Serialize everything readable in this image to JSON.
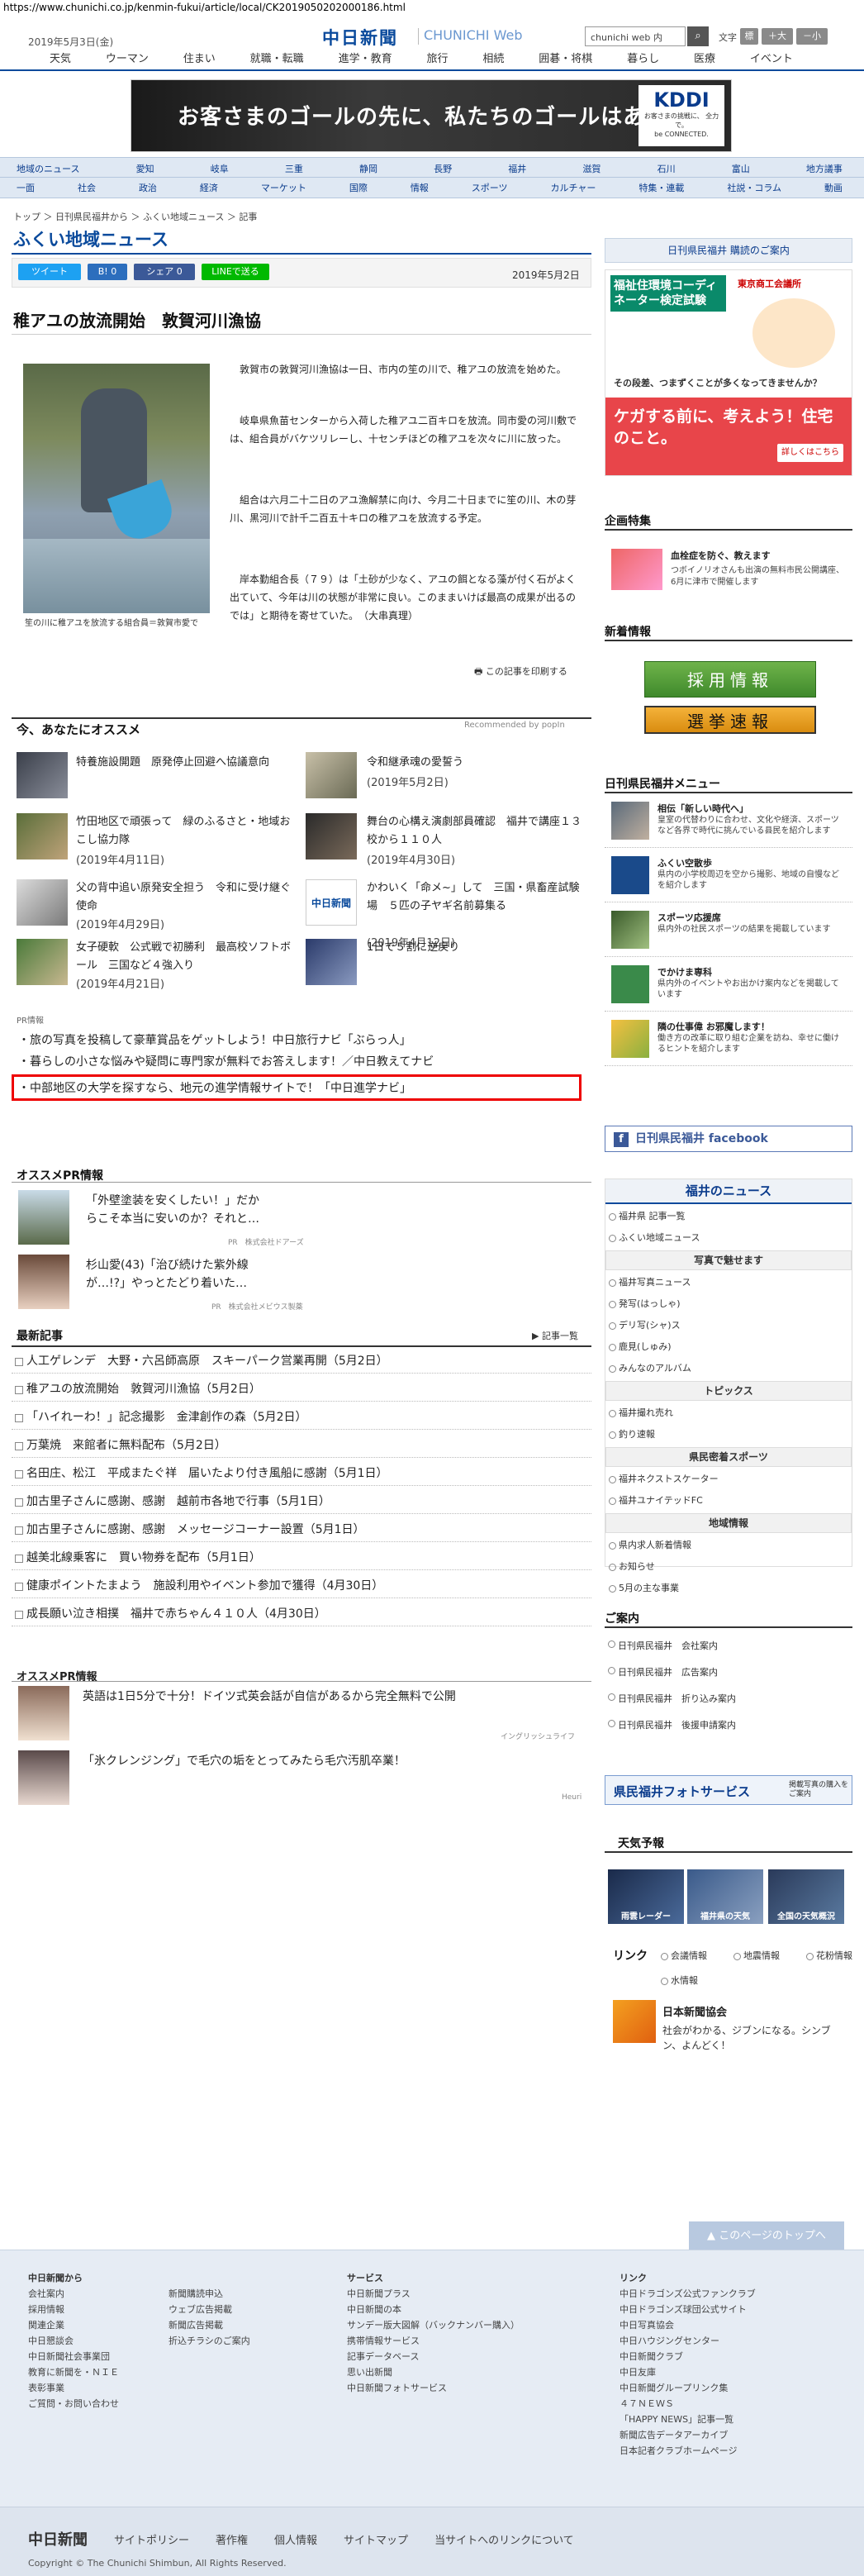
{
  "url": "https://www.chunichi.co.jp/kenmin-fukui/article/local/CK2019050202000186.html",
  "header": {
    "date": "2019年5月3日(金)",
    "logo_main": "中日新聞",
    "logo_web": "CHUNICHI Web",
    "search_placeholder": "chunichi web 内",
    "search_icon": "search-icon",
    "font_label": "文字",
    "font_buttons": [
      "標",
      "＋大",
      "－小"
    ],
    "gnav": [
      "天気",
      "ウーマン",
      "住まい",
      "就職・転職",
      "進学・教育",
      "旅行",
      "相続",
      "囲碁・将棋",
      "暮らし",
      "医療",
      "イベント"
    ]
  },
  "banner": {
    "text": "お客さまのゴールの先に、私たちのゴールはある。",
    "brand": "KDDI",
    "sub": "お客さまの挑戦に、\n全力で。",
    "tag": "be CONNECTED."
  },
  "catnav": {
    "row1": [
      "地域のニュース",
      "愛知",
      "岐阜",
      "三重",
      "静岡",
      "長野",
      "福井",
      "滋賀",
      "石川",
      "富山",
      "地方議事"
    ],
    "row2": [
      "一面",
      "社会",
      "政治",
      "経済",
      "マーケット",
      "国際",
      "情報",
      "スポーツ",
      "カルチャー",
      "特集・連載",
      "社説・コラム",
      "動画"
    ]
  },
  "breadcrumb": "トップ ＞ 日刊県民福井から ＞ ふくい地域ニュース ＞ 記事",
  "page_title": "ふくい地域ニュース",
  "share": {
    "tweet": "ツイート",
    "hatena": "B! 0",
    "fb": "シェア 0",
    "line": "LINEで送る"
  },
  "article": {
    "date": "2019年5月2日",
    "title": "稚アユの放流開始　敦賀河川漁協",
    "caption": "笙の川に稚アユを放流する組合員＝敦賀市愛で",
    "paras": [
      "敦賀市の敦賀河川漁協は一日、市内の笙の川で、稚アユの放流を始めた。",
      "岐阜県魚苗センターから入荷した稚アユ二百キロを放流。同市愛の河川敷では、組合員がバケツリレーし、十センチほどの稚アユを次々に川に放った。",
      "組合は六月二十二日のアユ漁解禁に向け、今月二十日までに笙の川、木の芽川、黒河川で計千二百五十キロの稚アユを放流する予定。",
      "岸本勤組合長（７９）は「土砂が少なく、アユの餌となる藻が付く石がよく出ていて、今年は川の状態が非常に良い。このままいけば最高の成果が出るのでは」と期待を寄せていた。　（大串真理）"
    ],
    "print": "この記事を印刷する"
  },
  "recommend": {
    "heading": "今、あなたにオススメ",
    "powered": "Recommended by popIn",
    "items": [
      {
        "title": "特養施設開題　原発停止回避へ協議意向",
        "date": ""
      },
      {
        "title": "令和継承魂の愛誓う",
        "date": "(2019年5月2日)"
      },
      {
        "title": "竹田地区で頑張って　緑のふるさと・地域おこし協力隊",
        "date": "(2019年4月11日)"
      },
      {
        "title": "舞台の心構え演劇部員確認　福井で講座１３校から１１０人",
        "date": "(2019年4月30日)"
      },
      {
        "title": "父の背中追い原発安全担う　令和に受け継ぐ使命",
        "date": "(2019年4月29日)"
      },
      {
        "title": "かわいく「命メ~」して　三国・県畜産試験場　５匹の子ヤギ名前募集る",
        "date": "(2019年4月12日)"
      },
      {
        "title": "女子硬軟　公式戦で初勝利　最高校ソフトボール　三国など４強入り",
        "date": "(2019年4月21日)"
      },
      {
        "title": "1日で５割に逆戻り",
        "date": ""
      }
    ],
    "thumb_logo": "中日新聞"
  },
  "pr": {
    "label": "PR情報",
    "items": [
      "旅の写真を投稿して豪華賞品をゲットしよう！中日旅行ナビ「ぶらっ人」",
      "暮らしの小さな悩みや疑問に専門家が無料でお答えします！／中日教えてナビ",
      "中部地区の大学を探すなら、地元の進学情報サイトで！「中日進学ナビ」"
    ]
  },
  "ospr": {
    "heading": "オススメPR情報",
    "items": [
      {
        "text": "「外壁塗装を安くしたい！」だからこそ本当に安いのか？それと…",
        "src": "PR　株式会社ドアーズ"
      },
      {
        "text": "杉山愛(43)「治び続けた紫外線が…!?」やっとたどり着いた…",
        "src": "PR　株式会社メビウス製薬"
      }
    ]
  },
  "news": {
    "heading": "最新記事",
    "more": "記事一覧",
    "items": [
      "人工ゲレンデ　大野・六呂師高原　スキーパーク営業再開（5月2日）",
      "稚アユの放流開始　敦賀河川漁協（5月2日）",
      "「ハイれーわ！」記念撮影　金津創作の森（5月2日）",
      "万葉焼　来館者に無料配布（5月2日）",
      "名田庄、松江　平成またぐ祥　届いたより付き風船に感謝（5月1日）",
      "加古里子さんに感謝、感謝　越前市各地で行事（5月1日）",
      "加古里子さんに感謝、感謝　メッセージコーナー設置（5月1日）",
      "越美北線乗客に　買い物券を配布（5月1日）",
      "健康ポイントたまよう　施設利用やイベント参加で獲得（4月30日）",
      "成長願い泣き相撲　福井で赤ちゃん４１０人（4月30日）"
    ]
  },
  "ospr2": {
    "heading": "オススメPR情報",
    "items": [
      {
        "text": "英語は1日5分で十分！ドイツ式英会話が自信があるから完全無料で公開",
        "src": "イングリッシュライフ"
      },
      {
        "text": "「氷クレンジング」で毛穴の垢をとってみたら毛穴汚肌卒業！",
        "src": "Heuri"
      }
    ]
  },
  "right": {
    "subscribe": "日刊県民福井 購読のご案内",
    "ad1_title": "福祉住環境コーディネーター検定試験",
    "ad1_org": "東京商工会議所",
    "ad1_q": "その段差、つまずくことが多くなってきませんか？",
    "ad1_b": "ケガする前に、考えよう！住宅のこと。",
    "ad1_btn": "詳しくはこちら",
    "kikaku": "企画特集",
    "kikaku_text": "血栓症を防ぐ、教えます",
    "kikaku_desc": "つボイノリオさんも出演の無料市民公開講座、6月に津市で開催します",
    "shinchaku": "新着情報",
    "saiyo": "採用情報",
    "senkyo": "選挙速報",
    "menu_head": "日刊県民福井メニュー",
    "menu": [
      {
        "t": "相伝「新しい時代へ」",
        "d": "皇室の代替わりに合わせ、文化や経済、スポーツなど各界で時代に挑んでいる县民を紹介します"
      },
      {
        "t": "ふくい空散歩",
        "d": "県内の小学校周辺を空から撮影、地域の自慢などを紹介します"
      },
      {
        "t": "スポーツ応援席",
        "d": "県内外の社民スポーツの結果を掲載しています"
      },
      {
        "t": "でかけま専科",
        "d": "県内外のイベントやお出かけ案内などを掲載しています"
      },
      {
        "t": "隣の仕事偉 お邪魔します！",
        "d": "働き方の改革に取り組む企業を訪ね、幸せに働けるヒントを紹介します"
      }
    ],
    "facebook": "日刊県民福井 facebook",
    "fukui_news": "福井のニュース",
    "fn_links": [
      "福井県 記事一覧",
      "ふくい地域ニュース"
    ],
    "photo_head": "写真で魅せます",
    "photo_links": [
      "福井写真ニュース",
      "発写(はっしゃ)",
      "デリ写(シャ)ス",
      "鹿見(しゅみ)",
      "みんなのアルバム"
    ],
    "topics_head": "トピックス",
    "topics_links": [
      "福井撮れ売れ",
      "釣り速報"
    ],
    "sports_head": "県民密着スポーツ",
    "sports_links": [
      "福井ネクストスケーター",
      "福井ユナイテッドFC"
    ],
    "chiiki_head": "地域情報",
    "chiiki_links": [
      "県内求人新着情報",
      "お知らせ",
      "5月の主な事業"
    ],
    "annai_head": "ご案内",
    "annai": [
      "日刊県民福井　会社案内",
      "日刊県民福井　広告案内",
      "日刊県民福井　折り込み案内",
      "日刊県民福井　後援申請案内"
    ],
    "photo_service": "県民福井フォトサービス",
    "photo_service_sub": "掲載写真の購入をご案内",
    "tenki_head": "天気予報",
    "tenki": [
      "福井県の天気",
      "全国の天気概況",
      "雨雲レーダー"
    ],
    "link_head": "リンク",
    "links": [
      "会議情報",
      "地震情報",
      "花粉情報",
      "水情報"
    ],
    "nihon_title": "日本新聞協会",
    "nihon_desc": "社会がわかる、ジブンになる。シンブン、よんどく！"
  },
  "pagetop": "このページのトップへ",
  "footer": {
    "col1_head": "中日新聞から",
    "col1": [
      "会社案内",
      "採用情報",
      "関連企業",
      "中日懇談会",
      "中日新聞社会事業団",
      "教育に新聞を・ＮＩＥ",
      "表彰事業",
      "ご質問・お問い合わせ"
    ],
    "col2": [
      "新聞購読申込",
      "ウェブ広告掲載",
      "新聞広告掲載",
      "折込チラシのご案内"
    ],
    "col3_head": "サービス",
    "col3": [
      "中日新聞プラス",
      "中日新聞の本",
      "サンデー版大図解（バックナンバー購入）",
      "携帯情報サービス",
      "記事データベース",
      "思い出新聞",
      "中日新聞フォトサービス"
    ],
    "col4_head": "リンク",
    "col4": [
      "中日ドラゴンズ公式ファンクラブ",
      "中日ドラゴンズ球団公式サイト",
      "中日写真協会",
      "中日ハウジングセンター",
      "中日新聞クラブ",
      "中日友庫",
      "中日新聞グループリンク集",
      "４７ＮＥＷＳ",
      "「HAPPY NEWS」記事一覧",
      "新聞広告データアーカイブ",
      "日本記者クラブホームページ"
    ],
    "bottom_logo": "中日新聞",
    "bottom_links": [
      "サイトポリシー",
      "著作権",
      "個人情報",
      "サイトマップ",
      "当サイトへのリンクについて"
    ],
    "copyright": "Copyright © The Chunichi Shimbun, All Rights Reserved."
  }
}
